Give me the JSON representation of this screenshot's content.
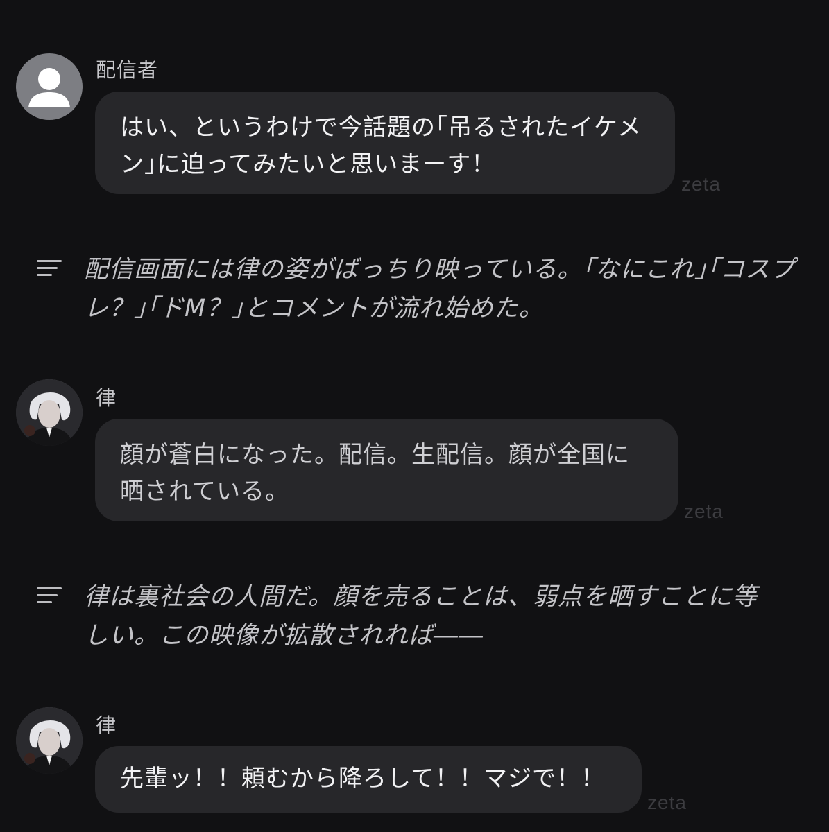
{
  "messages": [
    {
      "type": "chat",
      "sender": "配信者",
      "avatar": "default-user-avatar",
      "lines": [
        "はい、というわけで今話題の｢吊るされたイケメ",
        "ン｣に迫ってみたいと思いまーす！"
      ],
      "watermark": "zeta"
    },
    {
      "type": "narration",
      "icon": "narration-lines-icon",
      "lines": [
        "配信画面には律の姿がばっちり映っている。｢なにこれ｣｢コスプ",
        "レ？｣｢ドM？｣とコメントが流れ始めた。"
      ]
    },
    {
      "type": "chat",
      "sender": "律",
      "avatar": "character-avatar",
      "lines": [
        "顔が蒼白になった。配信。生配信。顔が全国に",
        "晒されている。"
      ],
      "watermark": "zeta"
    },
    {
      "type": "narration",
      "icon": "narration-lines-icon",
      "lines": [
        "律は裏社会の人間だ。顔を売ることは、弱点を晒すことに等",
        "しい。この映像が拡散されれば――"
      ]
    },
    {
      "type": "chat",
      "sender": "律",
      "avatar": "character-avatar",
      "lines": [
        "先輩ッ！！頼むから降ろして！！マジで！！"
      ],
      "watermark": "zeta"
    }
  ]
}
